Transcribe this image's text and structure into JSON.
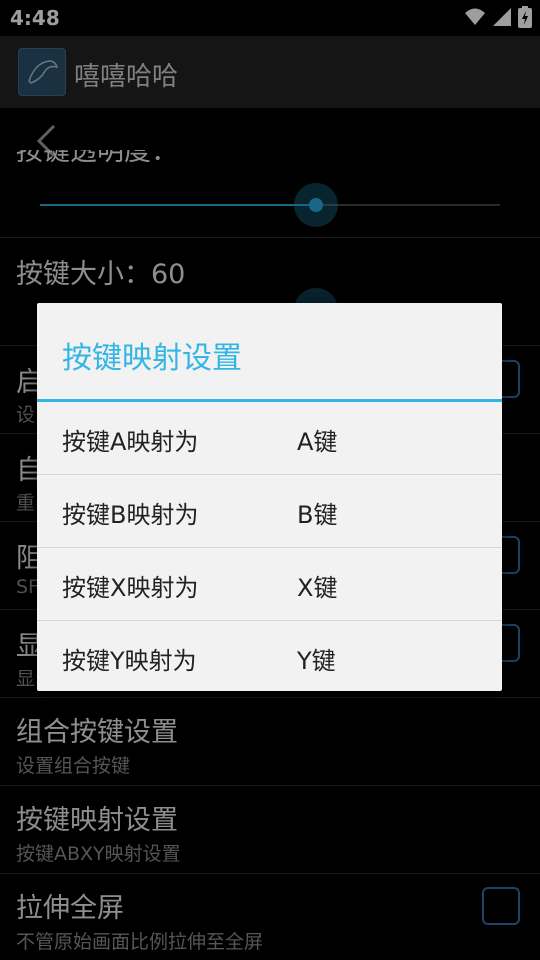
{
  "status_bar": {
    "time": "4:48"
  },
  "app_bar": {
    "title": "嘻嘻哈哈"
  },
  "settings": {
    "transparency_title_partial": "按键透明度：",
    "size_title": "按键大小：60",
    "start_title": "启",
    "start_sub": "设",
    "auto_title": "自",
    "auto_sub": "重",
    "block_title": "阻",
    "block_sub": "SF",
    "show_title": "显",
    "show_sub": "显",
    "combo_title": "组合按键设置",
    "combo_sub": "设置组合按键",
    "mapping_title": "按键映射设置",
    "mapping_sub": "按键ABXY映射设置",
    "stretch_title": "拉伸全屏",
    "stretch_sub": "不管原始画面比例拉伸至全屏",
    "transparency_level_percent": 60
  },
  "dialog": {
    "title": "按键映射设置",
    "rows": [
      {
        "label": "按键A映射为",
        "value": "A键"
      },
      {
        "label": "按键B映射为",
        "value": "B键"
      },
      {
        "label": "按键X映射为",
        "value": "X键"
      },
      {
        "label": "按键Y映射为",
        "value": "Y键"
      }
    ]
  },
  "colors": {
    "accent": "#33b5e5",
    "checkbox": "#2f6fa3",
    "dialog_bg": "#f2f2f2"
  }
}
